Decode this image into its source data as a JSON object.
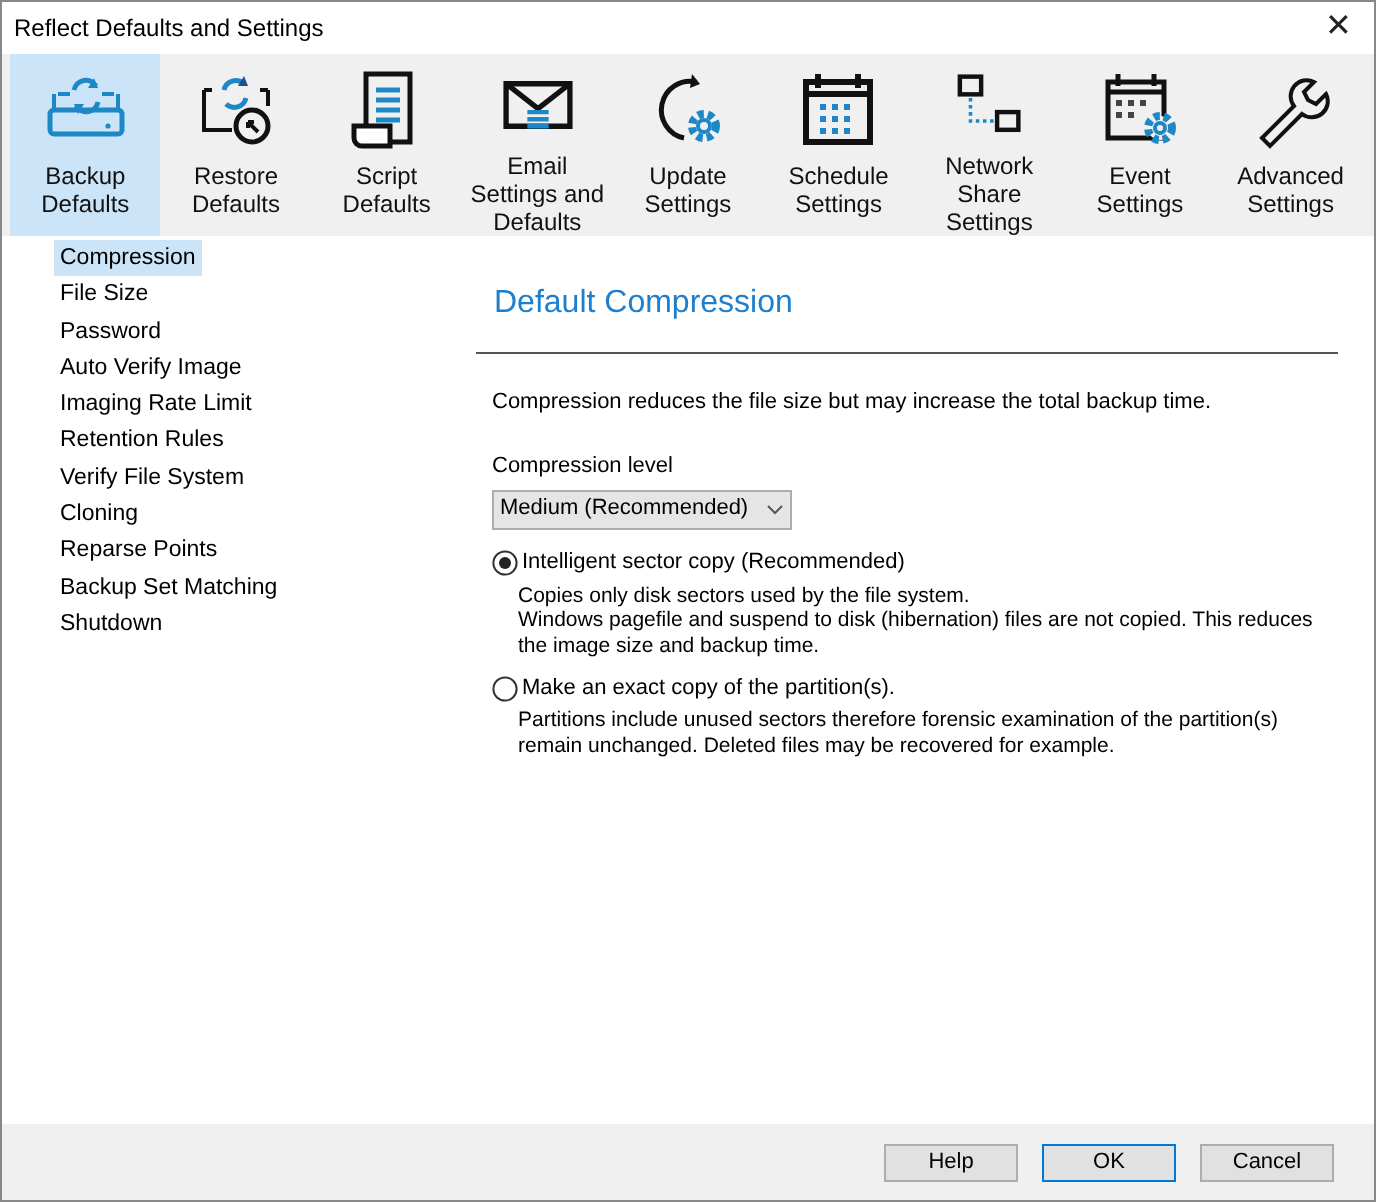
{
  "window": {
    "title": "Reflect Defaults and Settings",
    "close": "✕"
  },
  "toolbar": [
    {
      "label": "Backup Defaults",
      "selected": true
    },
    {
      "label": "Restore Defaults",
      "selected": false
    },
    {
      "label": "Script Defaults",
      "selected": false
    },
    {
      "label": "Email Settings and Defaults",
      "selected": false
    },
    {
      "label": "Update Settings",
      "selected": false
    },
    {
      "label": "Schedule Settings",
      "selected": false
    },
    {
      "label": "Network Share Settings",
      "selected": false
    },
    {
      "label": "Event Settings",
      "selected": false
    },
    {
      "label": "Advanced Settings",
      "selected": false
    }
  ],
  "sidebar": {
    "items": [
      {
        "label": "Compression",
        "selected": true
      },
      {
        "label": "File Size",
        "selected": false
      },
      {
        "label": "Password",
        "selected": false
      },
      {
        "label": "Auto Verify Image",
        "selected": false
      },
      {
        "label": "Imaging Rate Limit",
        "selected": false
      },
      {
        "label": "Retention Rules",
        "selected": false
      },
      {
        "label": "Verify File System",
        "selected": false
      },
      {
        "label": "Cloning",
        "selected": false
      },
      {
        "label": "Reparse Points",
        "selected": false
      },
      {
        "label": "Backup Set Matching",
        "selected": false
      },
      {
        "label": "Shutdown",
        "selected": false
      }
    ]
  },
  "panel": {
    "heading": "Default Compression",
    "intro": "Compression reduces the file size but may increase the total backup time.",
    "level_label": "Compression level",
    "level_value": "Medium (Recommended)",
    "options": [
      {
        "label": "Intelligent sector copy (Recommended)",
        "selected": true,
        "description": [
          "Copies only disk sectors used by the file system.",
          "Windows pagefile and suspend to disk (hibernation) files are not copied. This reduces the image size and backup time."
        ]
      },
      {
        "label": "Make an exact copy of the partition(s).",
        "selected": false,
        "description": [
          "Partitions include unused sectors therefore forensic examination of the partition(s) remain unchanged. Deleted files may be recovered for example."
        ]
      }
    ]
  },
  "buttons": [
    {
      "label": "Help",
      "selected": false
    },
    {
      "label": "OK",
      "selected": true
    },
    {
      "label": "Cancel",
      "selected": false
    }
  ]
}
